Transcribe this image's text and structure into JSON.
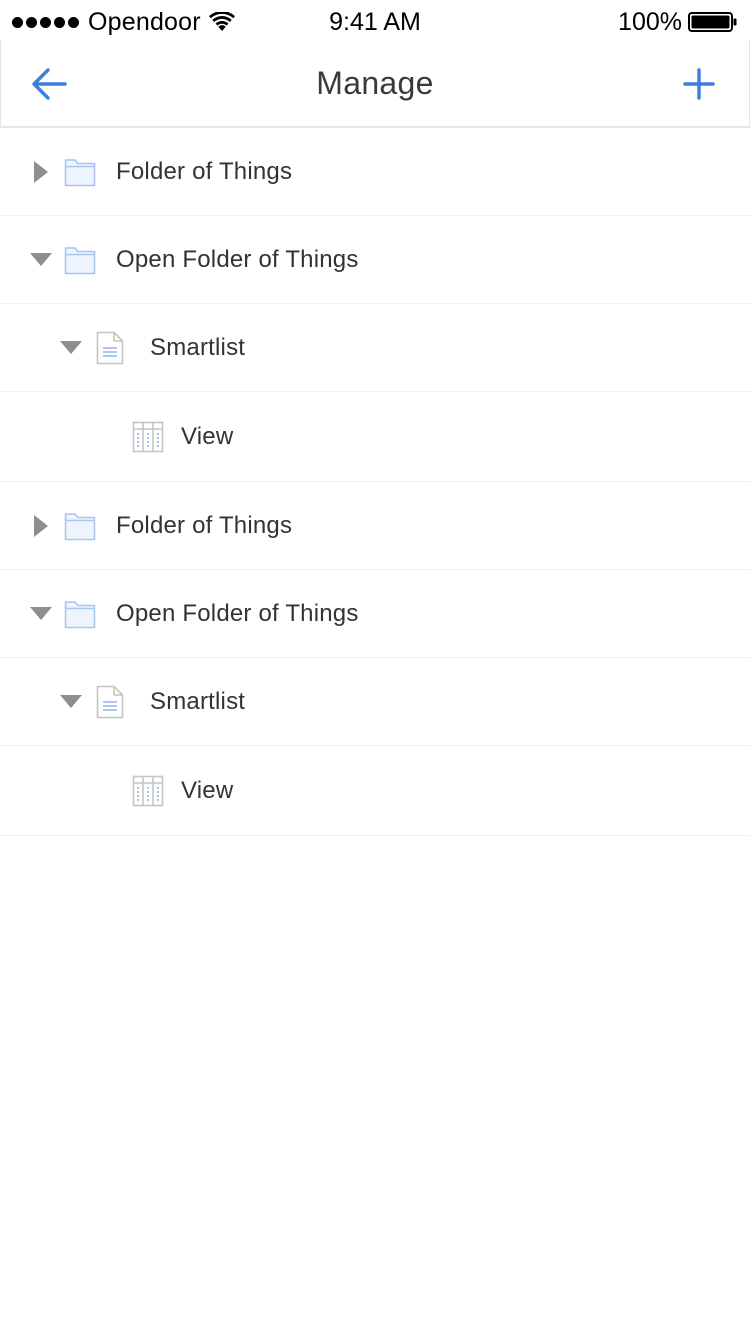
{
  "status_bar": {
    "carrier": "Opendoor",
    "time": "9:41 AM",
    "battery": "100%",
    "signal_icon": "signal-dots-icon",
    "wifi_icon": "wifi-icon",
    "battery_icon": "battery-icon"
  },
  "nav": {
    "title": "Manage",
    "back_icon": "back-arrow-icon",
    "add_icon": "plus-icon",
    "accent_color": "#3b7ddd"
  },
  "tree": {
    "rows": [
      {
        "type": "folder",
        "label": "Folder of Things",
        "expanded": false,
        "level": 0,
        "toggle_icon": "triangle-right-icon",
        "icon": "folder-icon"
      },
      {
        "type": "folder",
        "label": "Open Folder of Things",
        "expanded": true,
        "level": 0,
        "toggle_icon": "triangle-down-icon",
        "icon": "folder-icon"
      },
      {
        "type": "smartlist",
        "label": "Smartlist",
        "expanded": true,
        "level": 1,
        "toggle_icon": "triangle-down-icon",
        "icon": "document-icon"
      },
      {
        "type": "view",
        "label": "View",
        "level": 2,
        "icon": "table-view-icon"
      },
      {
        "type": "folder",
        "label": "Folder of Things",
        "expanded": false,
        "level": 0,
        "toggle_icon": "triangle-right-icon",
        "icon": "folder-icon"
      },
      {
        "type": "folder",
        "label": "Open Folder of Things",
        "expanded": true,
        "level": 0,
        "toggle_icon": "triangle-down-icon",
        "icon": "folder-icon"
      },
      {
        "type": "smartlist",
        "label": "Smartlist",
        "expanded": true,
        "level": 1,
        "toggle_icon": "triangle-down-icon",
        "icon": "document-icon"
      },
      {
        "type": "view",
        "label": "View",
        "level": 2,
        "icon": "table-view-icon"
      }
    ]
  }
}
